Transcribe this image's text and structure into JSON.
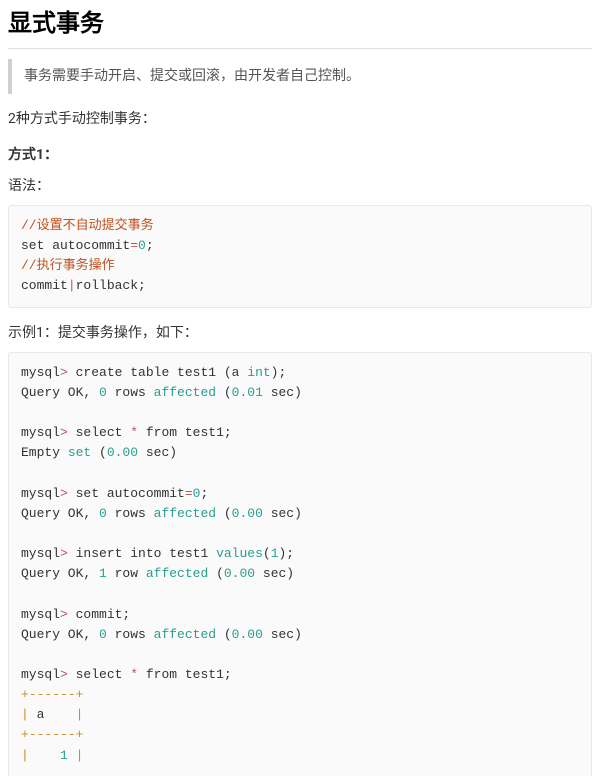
{
  "heading": "显式事务",
  "note": "事务需要手动开启、提交或回滚，由开发者自己控制。",
  "intro": "2种方式手动控制事务：",
  "method1_label": "方式1：",
  "syntax_label": "语法：",
  "code1": {
    "tokens": [
      {
        "t": "//设置不自动提交事务",
        "c": "com"
      },
      {
        "t": "\n"
      },
      {
        "t": "set autocommit"
      },
      {
        "t": "=",
        "c": "op"
      },
      {
        "t": "0",
        "c": "num"
      },
      {
        "t": ";"
      },
      {
        "t": "\n"
      },
      {
        "t": "//执行事务操作",
        "c": "com"
      },
      {
        "t": "\n"
      },
      {
        "t": "commit"
      },
      {
        "t": "|",
        "c": "op"
      },
      {
        "t": "rollback;"
      }
    ]
  },
  "example1_label": "示例1：提交事务操作，如下：",
  "code2": {
    "tokens": [
      {
        "t": "mysql"
      },
      {
        "t": ">",
        "c": "op"
      },
      {
        "t": " create table test1 (a "
      },
      {
        "t": "int",
        "c": "typ"
      },
      {
        "t": ");"
      },
      {
        "t": "\n"
      },
      {
        "t": "Query OK, "
      },
      {
        "t": "0",
        "c": "num"
      },
      {
        "t": " rows "
      },
      {
        "t": "affected",
        "c": "aff"
      },
      {
        "t": " ("
      },
      {
        "t": "0.01",
        "c": "num"
      },
      {
        "t": " sec)"
      },
      {
        "t": "\n"
      },
      {
        "t": "\n"
      },
      {
        "t": "mysql"
      },
      {
        "t": ">",
        "c": "op"
      },
      {
        "t": " select "
      },
      {
        "t": "*",
        "c": "op"
      },
      {
        "t": " from test1;"
      },
      {
        "t": "\n"
      },
      {
        "t": "Empty "
      },
      {
        "t": "set",
        "c": "kw"
      },
      {
        "t": " ("
      },
      {
        "t": "0.00",
        "c": "num"
      },
      {
        "t": " sec)"
      },
      {
        "t": "\n"
      },
      {
        "t": "\n"
      },
      {
        "t": "mysql"
      },
      {
        "t": ">",
        "c": "op"
      },
      {
        "t": " set autocommit"
      },
      {
        "t": "=",
        "c": "op"
      },
      {
        "t": "0",
        "c": "num"
      },
      {
        "t": ";"
      },
      {
        "t": "\n"
      },
      {
        "t": "Query OK, "
      },
      {
        "t": "0",
        "c": "num"
      },
      {
        "t": " rows "
      },
      {
        "t": "affected",
        "c": "aff"
      },
      {
        "t": " ("
      },
      {
        "t": "0.00",
        "c": "num"
      },
      {
        "t": " sec)"
      },
      {
        "t": "\n"
      },
      {
        "t": "\n"
      },
      {
        "t": "mysql"
      },
      {
        "t": ">",
        "c": "op"
      },
      {
        "t": " insert into test1 "
      },
      {
        "t": "values",
        "c": "aff"
      },
      {
        "t": "("
      },
      {
        "t": "1",
        "c": "num"
      },
      {
        "t": ");"
      },
      {
        "t": "\n"
      },
      {
        "t": "Query OK, "
      },
      {
        "t": "1",
        "c": "num"
      },
      {
        "t": " row "
      },
      {
        "t": "affected",
        "c": "aff"
      },
      {
        "t": " ("
      },
      {
        "t": "0.00",
        "c": "num"
      },
      {
        "t": " sec)"
      },
      {
        "t": "\n"
      },
      {
        "t": "\n"
      },
      {
        "t": "mysql"
      },
      {
        "t": ">",
        "c": "op"
      },
      {
        "t": " commit;"
      },
      {
        "t": "\n"
      },
      {
        "t": "Query OK, "
      },
      {
        "t": "0",
        "c": "num"
      },
      {
        "t": " rows "
      },
      {
        "t": "affected",
        "c": "aff"
      },
      {
        "t": " ("
      },
      {
        "t": "0.00",
        "c": "num"
      },
      {
        "t": " sec)"
      },
      {
        "t": "\n"
      },
      {
        "t": "\n"
      },
      {
        "t": "mysql"
      },
      {
        "t": ">",
        "c": "op"
      },
      {
        "t": " select "
      },
      {
        "t": "*",
        "c": "op"
      },
      {
        "t": " from test1;"
      },
      {
        "t": "\n"
      },
      {
        "t": "+------+",
        "c": "plus"
      },
      {
        "t": "\n"
      },
      {
        "t": "|",
        "c": "pipe"
      },
      {
        "t": " a    "
      },
      {
        "t": "|",
        "c": "pipe"
      },
      {
        "t": "\n"
      },
      {
        "t": "+------+",
        "c": "plus"
      },
      {
        "t": "\n"
      },
      {
        "t": "|",
        "c": "pipe"
      },
      {
        "t": "    "
      },
      {
        "t": "1",
        "c": "num"
      },
      {
        "t": " "
      },
      {
        "t": "|",
        "c": "pipe"
      }
    ]
  }
}
